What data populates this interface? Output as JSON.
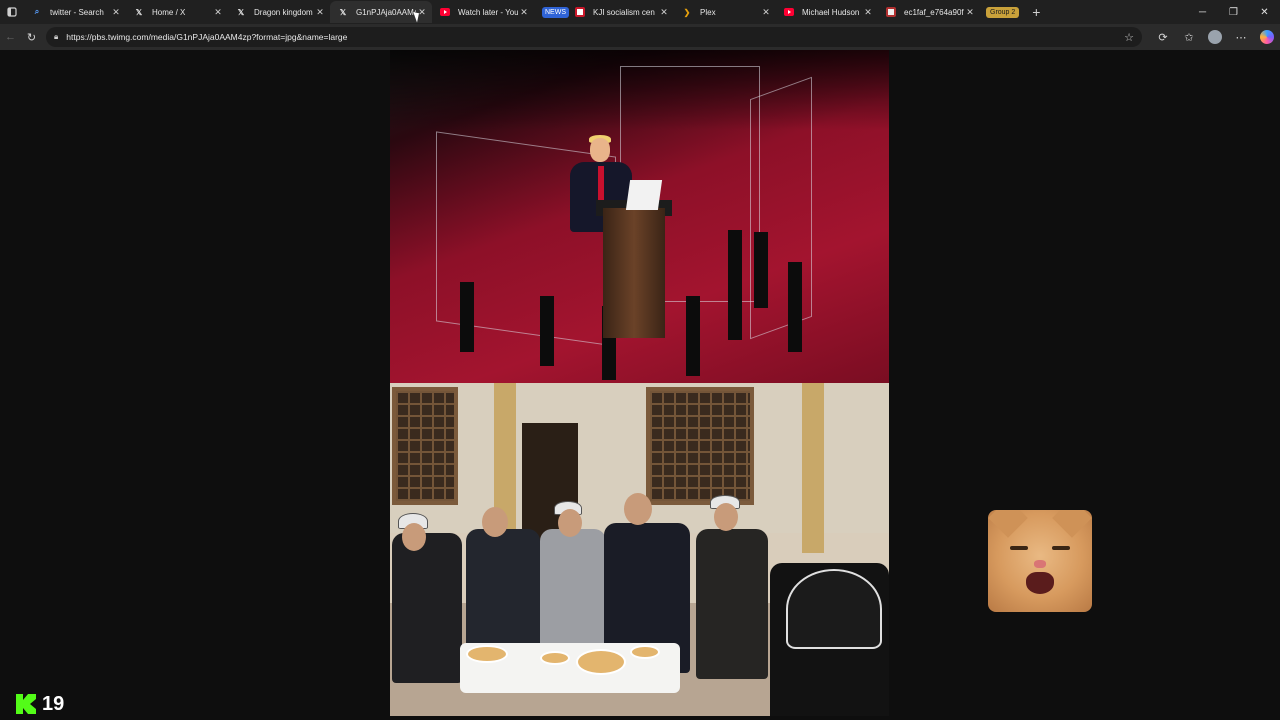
{
  "browser": {
    "tabs": [
      {
        "title": "twitter - Search",
        "icon": "search-icon",
        "active": false
      },
      {
        "title": "Home / X",
        "icon": "x-logo-icon",
        "active": false
      },
      {
        "title": "Dragon kingdom",
        "icon": "x-logo-icon",
        "active": false
      },
      {
        "title": "G1nPJAja0AAM4",
        "icon": "x-logo-icon",
        "active": true
      },
      {
        "title": "Watch later - You",
        "icon": "youtube-icon",
        "active": false
      },
      {
        "title": "KJI socialism cen",
        "icon": "news-site-icon",
        "badge": "NEWS",
        "active": false
      },
      {
        "title": "Plex",
        "icon": "plex-icon",
        "active": false
      },
      {
        "title": "Michael Hudson",
        "icon": "youtube-icon",
        "active": false
      },
      {
        "title": "ec1faf_e764a90f",
        "icon": "image-icon",
        "active": false
      }
    ],
    "tab_group_label": "Group 2",
    "address_bar": {
      "url": "https://pbs.twimg.com/media/G1nPJAja0AAM4zp?format=jpg&name=large"
    },
    "colors": {
      "tab_strip": "#202020",
      "toolbar": "#2b2b2b",
      "news_badge": "#2f63d6",
      "group_badge": "#c9a13a"
    }
  },
  "content": {
    "image_frame": {
      "top_photo": "speaker at podium on red stage inside glass enclosure",
      "bottom_photo": "group of men seated in a courtyard around a table of food"
    }
  },
  "overlays": {
    "stream_counter": {
      "value": "19",
      "brand_color": "#53fc18"
    }
  }
}
